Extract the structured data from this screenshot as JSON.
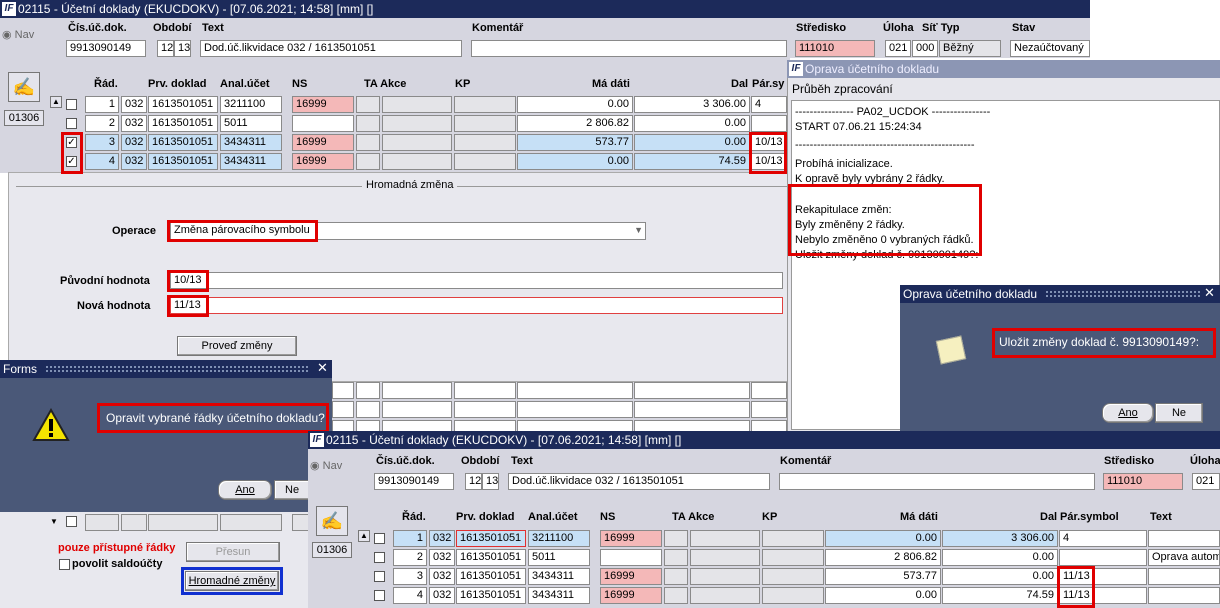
{
  "main": {
    "title": "02115 - Účetní doklady (EKUCDOKV) - [07.06.2021; 14:58]  [mm]  []",
    "nav": "Nav",
    "code": "01306",
    "hdr_labels": {
      "cis": "Čís.úč.dok.",
      "obdobi": "Období",
      "text": "Text",
      "komentar": "Komentář",
      "stredisko": "Středisko",
      "uloha": "Úloha",
      "sit_typ": "Síť Typ",
      "stav": "Stav"
    },
    "hdr_values": {
      "cis": "9913090149",
      "obd1": "12",
      "obd2": "13",
      "text": "Dod.úč.likvidace 032 / 1613501051",
      "komentar": "",
      "stredisko": "111010",
      "uloha": "021",
      "sit": "000",
      "typ": "Běžný",
      "stav": "Nezaúčtovaný"
    },
    "cols": {
      "rad": "Řád.",
      "prv": "Prv. doklad",
      "anal": "Anal.účet",
      "ns": "NS",
      "ta": "TA Akce",
      "kp": "KP",
      "ma": "Má dáti",
      "dal": "Dal",
      "par": "Pár.sy"
    },
    "rows": [
      {
        "checked": "",
        "rad": "1",
        "c": "032",
        "prv": "1613501051",
        "anal": "3211100",
        "ns": "16999",
        "ma": "0.00",
        "dal": "3 306.00",
        "par": "4"
      },
      {
        "checked": "",
        "rad": "2",
        "c": "032",
        "prv": "1613501051",
        "anal": "5011",
        "ns": "",
        "ma": "2 806.82",
        "dal": "0.00",
        "par": ""
      },
      {
        "checked": "✓",
        "rad": "3",
        "c": "032",
        "prv": "1613501051",
        "anal": "3434311",
        "ns": "16999",
        "ma": "573.77",
        "dal": "0.00",
        "par": "10/13"
      },
      {
        "checked": "✓",
        "rad": "4",
        "c": "032",
        "prv": "1613501051",
        "anal": "3434311",
        "ns": "16999",
        "ma": "0.00",
        "dal": "74.59",
        "par": "10/13"
      }
    ]
  },
  "hromadna": {
    "title": "Hromadná změna",
    "operace_label": "Operace",
    "operace_value": "Změna párovacího symbolu",
    "puvodni_label": "Původní hodnota",
    "puvodni_value": "10/13",
    "nova_label": "Nová hodnota",
    "nova_value": "11/13",
    "proved": "Proveď změny"
  },
  "bottom_left": {
    "pristupne": "pouze přístupné řádky",
    "presun": "Přesun",
    "povolit": "povolit saldoúčty",
    "hromadne": "Hromadné změny"
  },
  "forms_dialog": {
    "title": "Forms",
    "message": "Opravit vybrané řádky účetního dokladu?",
    "ano": "Ano",
    "ne": "Ne"
  },
  "oprava_panel": {
    "title": "Oprava účetního dokladu",
    "subtitle": "Průběh zpracování",
    "log": [
      "---------------- PA02_UCDOK ----------------",
      "START 07.06.21 15:24:34",
      "-------------------------------------------------",
      "Probíhá inicializace.",
      "K opravě byly vybrány 2 řádky.",
      "Rekapitulace změn:",
      "Byly změněny 2 řádky.",
      "Nebylo změněno 0 vybraných řádků.",
      "Uložit změny doklad č. 9913090149?:"
    ]
  },
  "confirm_dialog": {
    "title": "Oprava účetního dokladu",
    "message": "Uložit změny doklad č. 9913090149?:",
    "ano": "Ano",
    "ne": "Ne"
  },
  "second": {
    "title": "02115 - Účetní doklady (EKUCDOKV) - [07.06.2021; 14:58]  [mm]  []",
    "nav": "Nav",
    "code": "01306",
    "hdr_labels": {
      "cis": "Čís.úč.dok.",
      "obdobi": "Období",
      "text": "Text",
      "komentar": "Komentář",
      "stredisko": "Středisko",
      "uloha": "Úloha"
    },
    "hdr_values": {
      "cis": "9913090149",
      "obd1": "12",
      "obd2": "13",
      "text": "Dod.úč.likvidace 032 / 1613501051",
      "stredisko": "111010",
      "uloha": "021"
    },
    "cols": {
      "rad": "Řád.",
      "prv": "Prv. doklad",
      "anal": "Anal.účet",
      "ns": "NS",
      "ta": "TA Akce",
      "kp": "KP",
      "ma": "Má dáti",
      "dal": "Dal",
      "par": "Pár.symbol",
      "text": "Text"
    },
    "rows": [
      {
        "rad": "1",
        "c": "032",
        "prv": "1613501051",
        "anal": "3211100",
        "ns": "16999",
        "ma": "0.00",
        "dal": "3 306.00",
        "par": "4",
        "text": ""
      },
      {
        "rad": "2",
        "c": "032",
        "prv": "1613501051",
        "anal": "5011",
        "ns": "",
        "ma": "2 806.82",
        "dal": "0.00",
        "par": "",
        "text": "Oprava autom"
      },
      {
        "rad": "3",
        "c": "032",
        "prv": "1613501051",
        "anal": "3434311",
        "ns": "16999",
        "ma": "573.77",
        "dal": "0.00",
        "par": "11/13",
        "text": ""
      },
      {
        "rad": "4",
        "c": "032",
        "prv": "1613501051",
        "anal": "3434311",
        "ns": "16999",
        "ma": "0.00",
        "dal": "74.59",
        "par": "11/13",
        "text": ""
      }
    ]
  }
}
